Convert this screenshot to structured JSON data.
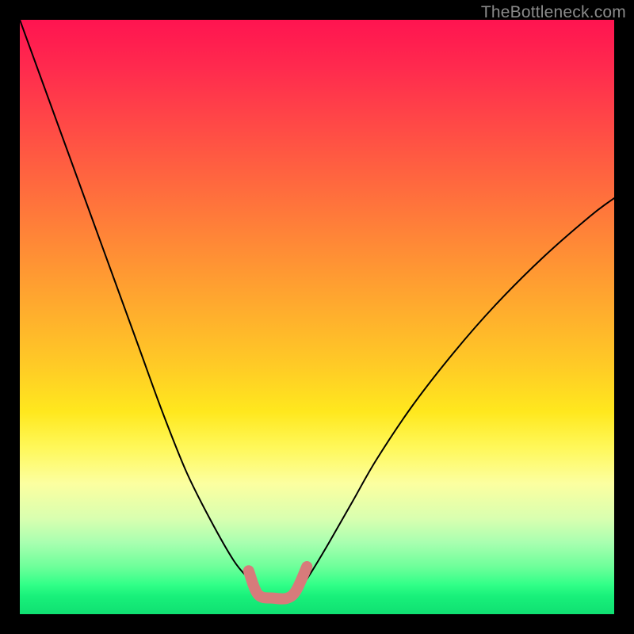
{
  "watermark": "TheBottleneck.com",
  "chart_data": {
    "type": "line",
    "title": "",
    "xlabel": "",
    "ylabel": "",
    "xlim": [
      0,
      100
    ],
    "ylim": [
      0,
      100
    ],
    "grid": false,
    "series": [
      {
        "name": "curve-left",
        "x": [
          0,
          4,
          8,
          12,
          16,
          20,
          24,
          28,
          32,
          36,
          38.5,
          40.5
        ],
        "y": [
          100,
          89,
          78,
          67,
          56,
          45,
          34,
          24,
          16,
          9,
          6,
          4
        ],
        "color": "#000000",
        "stroke_width": 2
      },
      {
        "name": "curve-right",
        "x": [
          47,
          49,
          52,
          56,
          60,
          66,
          73,
          80,
          88,
          96,
          100
        ],
        "y": [
          4,
          7,
          12,
          19,
          26,
          35,
          44,
          52,
          60,
          67,
          70
        ],
        "color": "#000000",
        "stroke_width": 2
      },
      {
        "name": "bottom-bracket",
        "x": [
          38.5,
          40.1,
          42.7,
          45.0,
          46.5,
          48.3
        ],
        "y": [
          7.3,
          3.3,
          2.7,
          2.7,
          4.0,
          8.0
        ],
        "color": "#d77b7b",
        "stroke_width": 14
      }
    ]
  }
}
